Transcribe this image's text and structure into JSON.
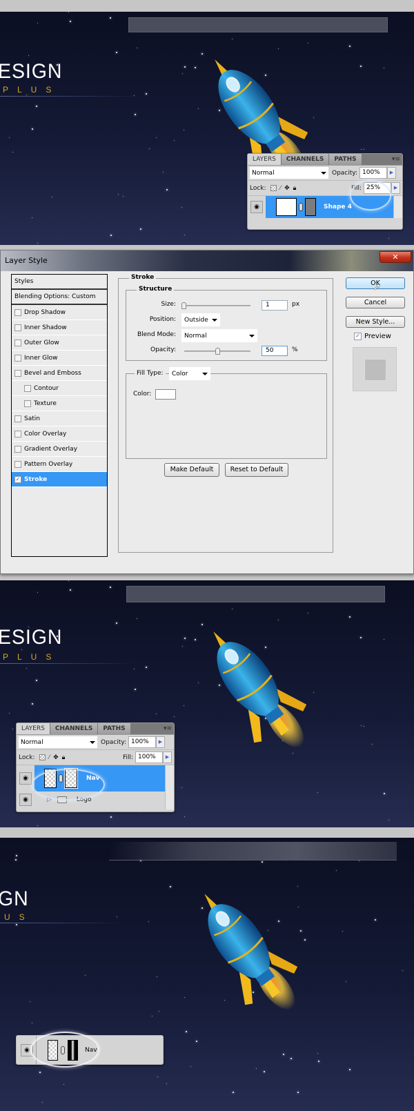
{
  "brand": {
    "logo_text_1": "ESIGN",
    "logo_sub_1": "PLUS",
    "logo_text_2": "GN",
    "logo_sub_2": "US"
  },
  "colors": {
    "selection_blue": "#3797f5",
    "logo_gold": "#d8a520",
    "space_top": "#0c0f22",
    "space_bottom": "#252c50"
  },
  "panel1": {
    "layers": {
      "tabs": [
        "LAYERS",
        "CHANNELS",
        "PATHS"
      ],
      "active_tab": "LAYERS",
      "blend_mode": "Normal",
      "opacity_label": "Opacity:",
      "opacity_value": "100%",
      "lock_label": "Lock:",
      "fill_label": "Fill:",
      "fill_value": "25%",
      "layer_name": "Shape 4"
    }
  },
  "dialog": {
    "title": "Layer Style",
    "close_icon": "close-x",
    "styles_header": "Styles",
    "blending_options": "Blending Options: Custom",
    "styles": [
      {
        "label": "Drop Shadow",
        "checked": false,
        "indent": false
      },
      {
        "label": "Inner Shadow",
        "checked": false,
        "indent": false
      },
      {
        "label": "Outer Glow",
        "checked": false,
        "indent": false
      },
      {
        "label": "Inner Glow",
        "checked": false,
        "indent": false
      },
      {
        "label": "Bevel and Emboss",
        "checked": false,
        "indent": false
      },
      {
        "label": "Contour",
        "checked": false,
        "indent": true
      },
      {
        "label": "Texture",
        "checked": false,
        "indent": true
      },
      {
        "label": "Satin",
        "checked": false,
        "indent": false
      },
      {
        "label": "Color Overlay",
        "checked": false,
        "indent": false
      },
      {
        "label": "Gradient Overlay",
        "checked": false,
        "indent": false
      },
      {
        "label": "Pattern Overlay",
        "checked": false,
        "indent": false
      },
      {
        "label": "Stroke",
        "checked": true,
        "indent": false,
        "selected": true
      }
    ],
    "stroke": {
      "section_title": "Stroke",
      "structure_title": "Structure",
      "size_label": "Size:",
      "size_value": "1",
      "size_unit": "px",
      "position_label": "Position:",
      "position_value": "Outside",
      "blend_mode_label": "Blend Mode:",
      "blend_mode_value": "Normal",
      "opacity_label": "Opacity:",
      "opacity_value": "50",
      "opacity_unit": "%",
      "opacity_slider_fraction": 0.5,
      "size_slider_fraction": 0.0,
      "fill_type_label": "Fill Type:",
      "fill_type_value": "Color",
      "color_label": "Color:",
      "color_value": "#ffffff"
    },
    "buttons": {
      "make_default": "Make Default",
      "reset_default": "Reset to Default",
      "ok": "OK",
      "cancel": "Cancel",
      "new_style": "New Style...",
      "preview_label": "Preview",
      "preview_checked": true
    }
  },
  "panel3": {
    "layers": {
      "tabs": [
        "LAYERS",
        "CHANNELS",
        "PATHS"
      ],
      "active_tab": "LAYERS",
      "blend_mode": "Normal",
      "opacity_label": "Opacity:",
      "opacity_value": "100%",
      "lock_label": "Lock:",
      "fill_label": "Fill:",
      "fill_value": "100%",
      "layers": [
        {
          "name": "Nav",
          "selected": true
        },
        {
          "name": "Logo",
          "group": true
        }
      ]
    }
  },
  "panel4": {
    "layer_name": "Nav"
  }
}
